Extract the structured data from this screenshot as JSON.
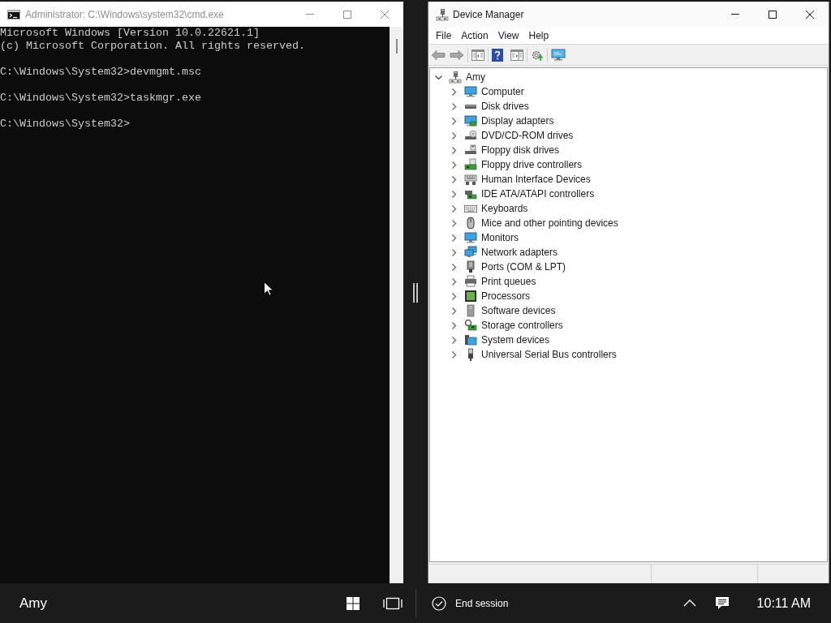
{
  "cmd_window": {
    "title": "Administrator: C:\\Windows\\system32\\cmd.exe",
    "active": false,
    "output_blocks": [
      {
        "lines": [
          "Microsoft Windows [Version 10.0.22621.1]",
          "(c) Microsoft Corporation. All rights reserved."
        ]
      },
      {
        "lines": [
          "C:\\Windows\\System32>devmgmt.msc"
        ]
      },
      {
        "lines": [
          "C:\\Windows\\System32>taskmgr.exe"
        ]
      },
      {
        "lines": [
          "C:\\Windows\\System32>"
        ]
      }
    ]
  },
  "device_manager": {
    "title": "Device Manager",
    "active": true,
    "menu": [
      "File",
      "Action",
      "View",
      "Help"
    ],
    "tree": {
      "label": "Amy",
      "expanded": true,
      "children": [
        {
          "label": "Computer",
          "expanded": false
        },
        {
          "label": "Disk drives",
          "expanded": false
        },
        {
          "label": "Display adapters",
          "expanded": false
        },
        {
          "label": "DVD/CD-ROM drives",
          "expanded": false
        },
        {
          "label": "Floppy disk drives",
          "expanded": false
        },
        {
          "label": "Floppy drive controllers",
          "expanded": false
        },
        {
          "label": "Human Interface Devices",
          "expanded": false
        },
        {
          "label": "IDE ATA/ATAPI controllers",
          "expanded": false
        },
        {
          "label": "Keyboards",
          "expanded": false
        },
        {
          "label": "Mice and other pointing devices",
          "expanded": false
        },
        {
          "label": "Monitors",
          "expanded": false
        },
        {
          "label": "Network adapters",
          "expanded": false
        },
        {
          "label": "Ports (COM & LPT)",
          "expanded": false
        },
        {
          "label": "Print queues",
          "expanded": false
        },
        {
          "label": "Processors",
          "expanded": false
        },
        {
          "label": "Software devices",
          "expanded": false
        },
        {
          "label": "Storage controllers",
          "expanded": false
        },
        {
          "label": "System devices",
          "expanded": false
        },
        {
          "label": "Universal Serial Bus controllers",
          "expanded": false
        }
      ]
    }
  },
  "taskbar": {
    "user": "Amy",
    "end_session": "End session",
    "clock": "10:11 AM"
  }
}
